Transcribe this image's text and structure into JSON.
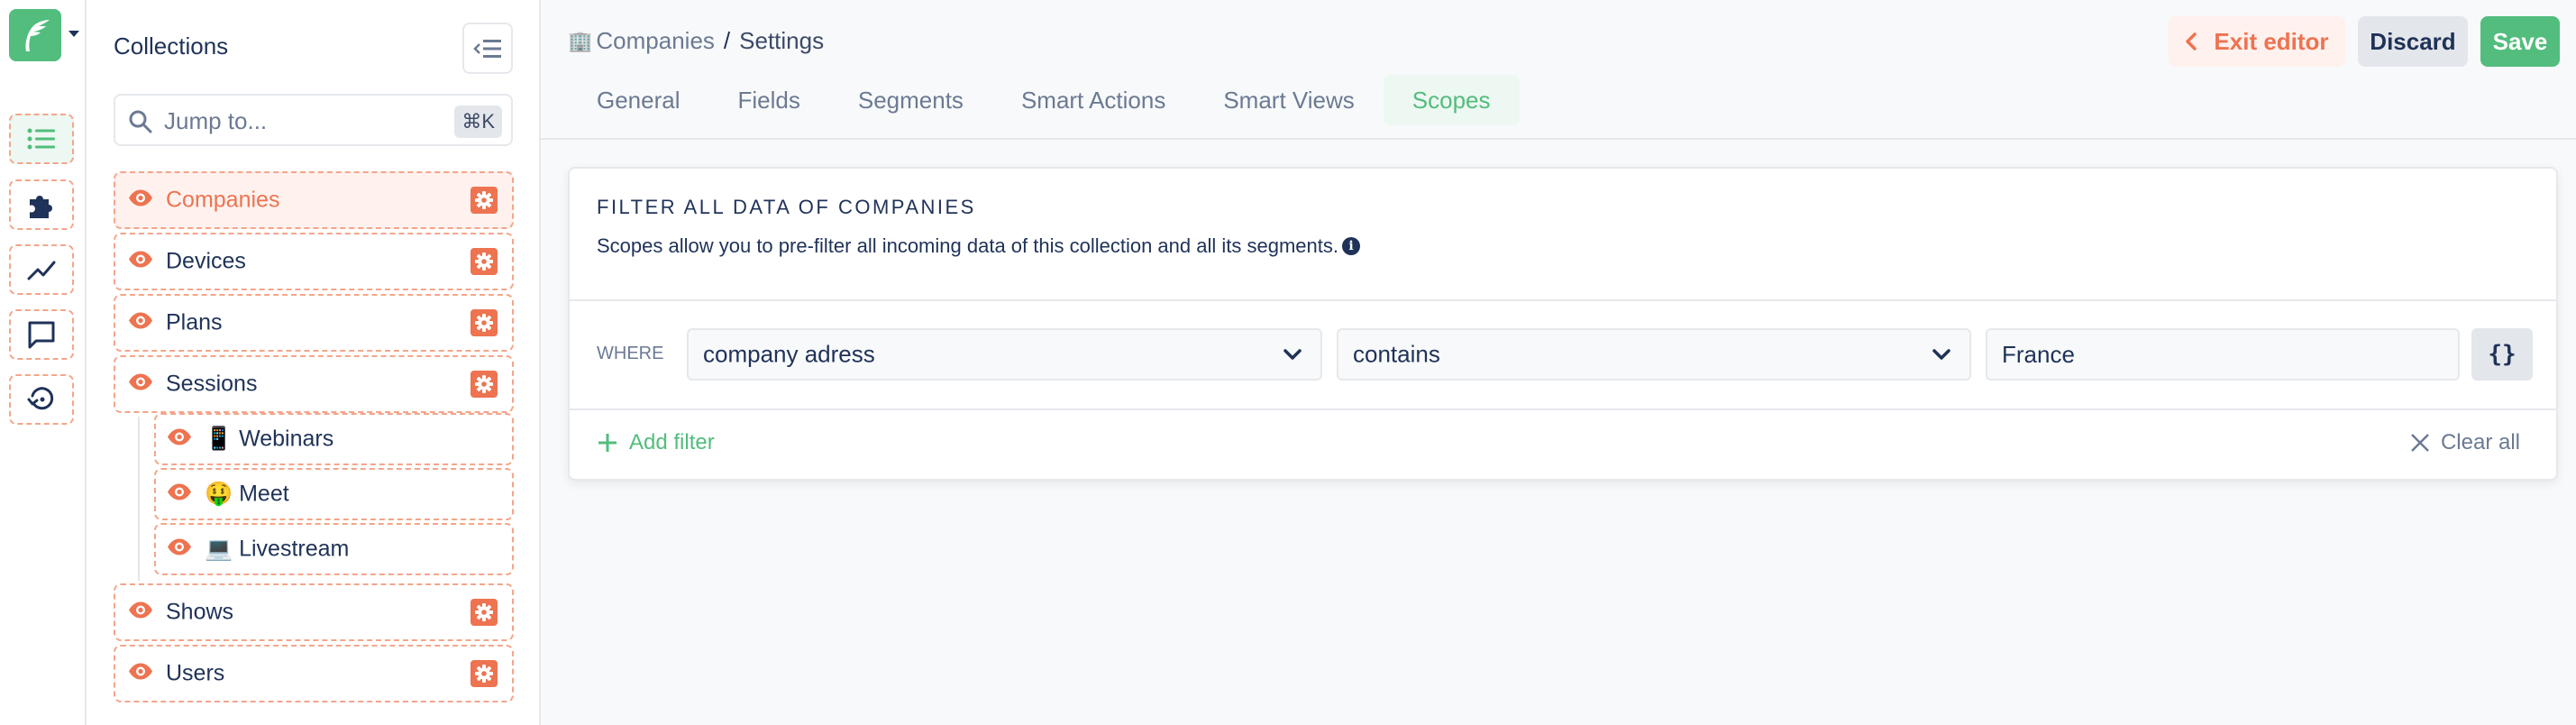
{
  "rail": {
    "logo_letter": "F",
    "items": [
      {
        "name": "collections",
        "icon": "list-icon",
        "active": true
      },
      {
        "name": "integrations",
        "icon": "puzzle-icon",
        "active": false
      },
      {
        "name": "analytics",
        "icon": "chart-line-icon",
        "active": false
      },
      {
        "name": "inbox",
        "icon": "chat-bubble-icon",
        "active": false
      },
      {
        "name": "history",
        "icon": "history-icon",
        "active": false
      }
    ]
  },
  "panel": {
    "title": "Collections",
    "search": {
      "placeholder": "Jump to...",
      "value": "",
      "shortcut": "⌘K"
    },
    "collections": [
      {
        "label": "Companies",
        "active": true,
        "has_settings": true
      },
      {
        "label": "Devices",
        "active": false,
        "has_settings": true
      },
      {
        "label": "Plans",
        "active": false,
        "has_settings": true
      },
      {
        "label": "Sessions",
        "active": false,
        "has_settings": true,
        "children": [
          {
            "emoji": "📱",
            "label": "Webinars"
          },
          {
            "emoji": "🤑",
            "label": "Meet"
          },
          {
            "emoji": "💻",
            "label": "Livestream"
          }
        ]
      },
      {
        "label": "Shows",
        "active": false,
        "has_settings": true
      },
      {
        "label": "Users",
        "active": false,
        "has_settings": true
      }
    ]
  },
  "header": {
    "breadcrumb": {
      "emoji": "🏢",
      "parent": "Companies",
      "separator": "/",
      "current": "Settings"
    },
    "tabs": [
      {
        "label": "General",
        "active": false
      },
      {
        "label": "Fields",
        "active": false
      },
      {
        "label": "Segments",
        "active": false
      },
      {
        "label": "Smart Actions",
        "active": false
      },
      {
        "label": "Smart Views",
        "active": false
      },
      {
        "label": "Scopes",
        "active": true
      }
    ],
    "buttons": {
      "exit": "Exit editor",
      "discard": "Discard",
      "save": "Save"
    }
  },
  "scopes": {
    "title": "FILTER ALL DATA OF COMPANIES",
    "description": "Scopes allow you to pre-filter all incoming data of this collection and all its segments.",
    "info_icon": "i",
    "where_label": "WHERE",
    "filter": {
      "field": "company adress",
      "operator": "contains",
      "value": "France",
      "dynamic_button": "{}"
    },
    "add_filter": "Add filter",
    "clear_all": "Clear all"
  },
  "colors": {
    "brand_green": "#52bd7d",
    "accent_orange": "#ee7350",
    "text_dark": "#1f3258",
    "text_muted": "#6b7a93"
  }
}
